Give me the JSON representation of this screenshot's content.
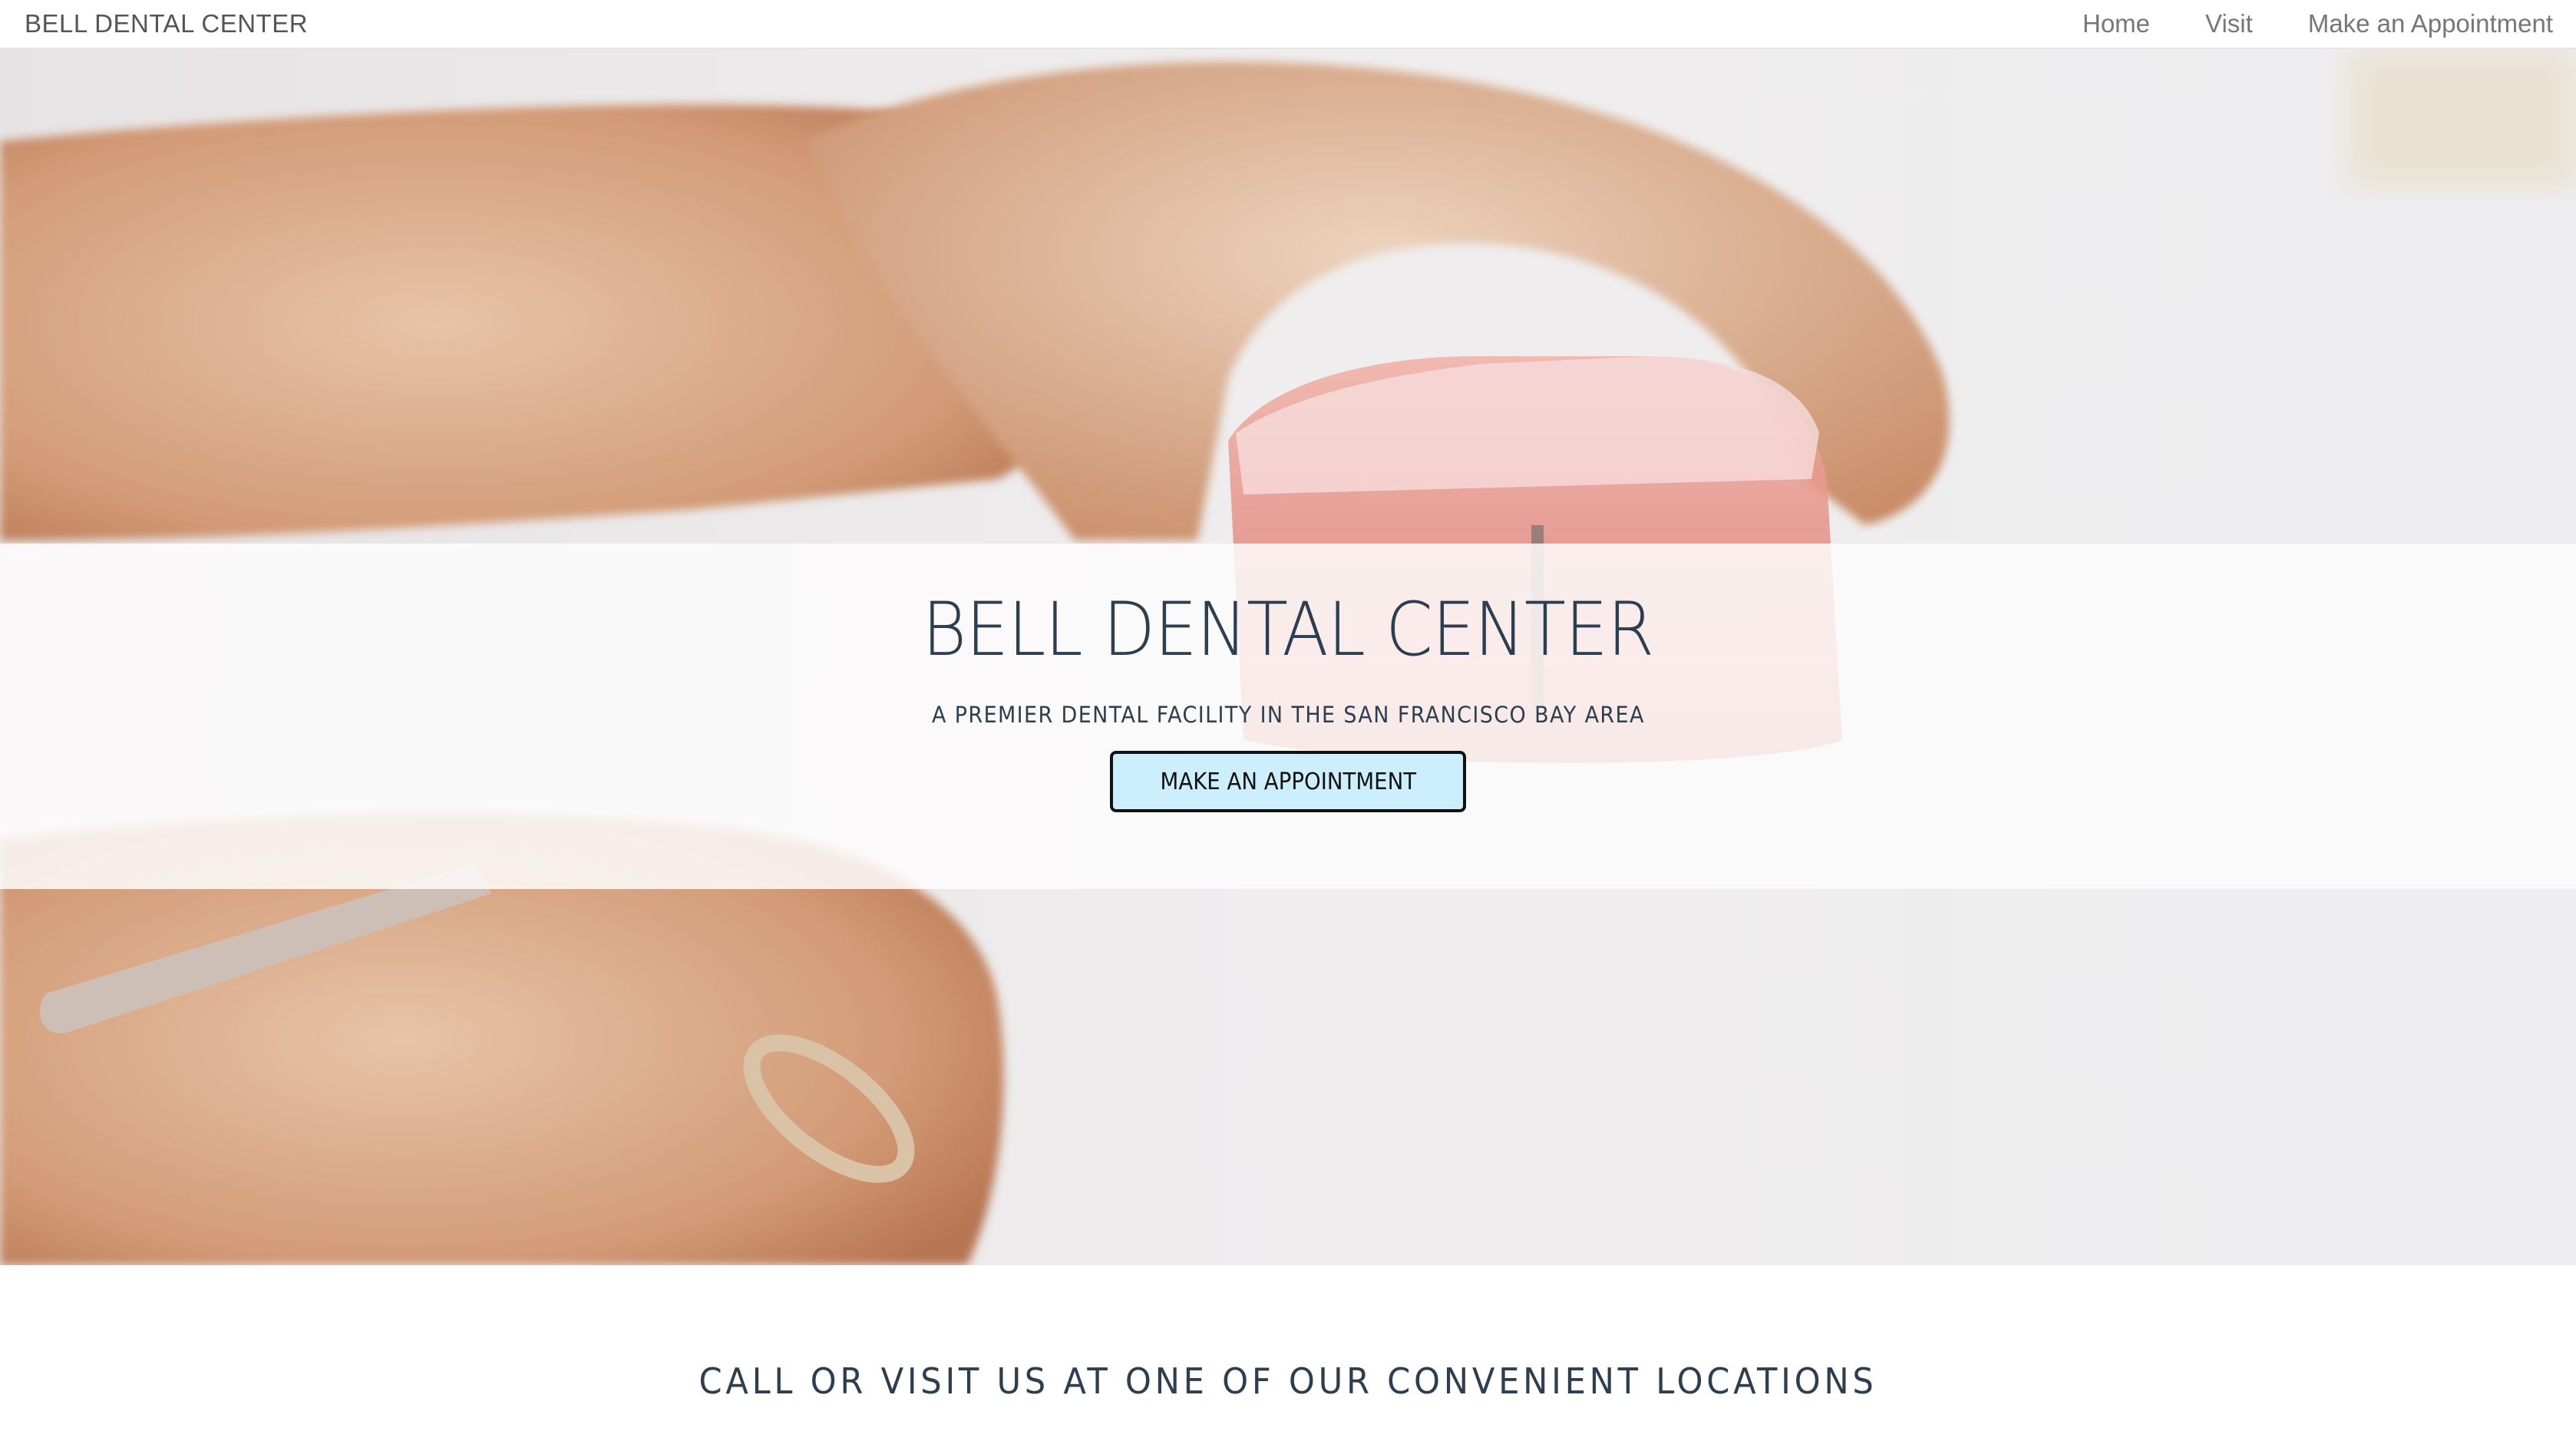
{
  "navbar": {
    "brand": "BELL DENTAL CENTER",
    "links": [
      {
        "label": "Home"
      },
      {
        "label": "Visit"
      },
      {
        "label": "Make an Appointment"
      }
    ]
  },
  "hero": {
    "title": "BELL DENTAL CENTER",
    "subtitle": "A PREMIER DENTAL FACILITY IN THE SAN FRANCISCO BAY AREA",
    "cta_label": "MAKE AN APPOINTMENT",
    "background": "photo-hands-holding-dental-model"
  },
  "locations": {
    "heading": "CALL OR VISIT US AT ONE OF OUR CONVENIENT LOCATIONS"
  },
  "colors": {
    "text_dark": "#2c3e50",
    "nav_text": "#777777",
    "cta_bg": "#cdeefc"
  }
}
